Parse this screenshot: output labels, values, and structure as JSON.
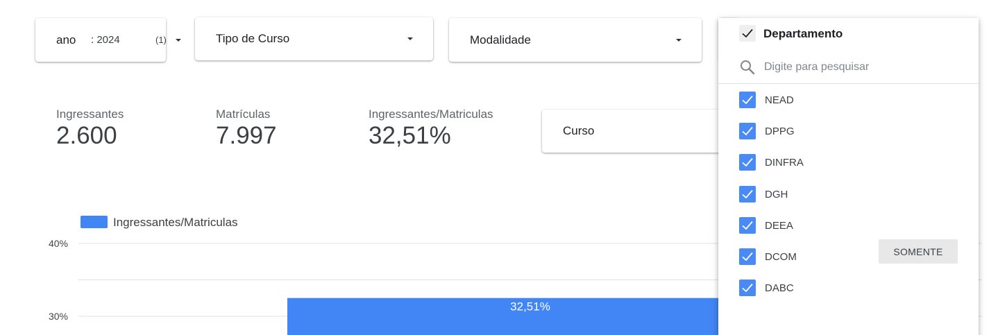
{
  "filters": {
    "ano": {
      "label": "ano",
      "value": "2024",
      "count": "(1)"
    },
    "tipo_curso": {
      "label": "Tipo de Curso"
    },
    "modalidade": {
      "label": "Modalidade"
    },
    "curso": {
      "label": "Curso"
    }
  },
  "kpis": [
    {
      "label": "Ingressantes",
      "value": "2.600"
    },
    {
      "label": "Matrículas",
      "value": "7.997"
    },
    {
      "label": "Ingressantes/Matriculas",
      "value": "32,51%"
    }
  ],
  "chart_data": {
    "type": "bar",
    "categories": [
      ""
    ],
    "series": [
      {
        "name": "Ingressantes/Matriculas",
        "values": [
          32.51
        ]
      }
    ],
    "data_labels": [
      "32,51%"
    ],
    "ytick_labels": [
      "40%",
      "30%"
    ],
    "yticks": [
      40,
      35,
      30
    ],
    "ylim": [
      28,
      40
    ],
    "legend": "top-left",
    "grid": true,
    "color": "#4285f4"
  },
  "dropdown": {
    "title": "Departamento",
    "search_placeholder": "Digite para pesquisar",
    "items": [
      {
        "label": "NEAD",
        "checked": true
      },
      {
        "label": "DPPG",
        "checked": true
      },
      {
        "label": "DINFRA",
        "checked": true
      },
      {
        "label": "DGH",
        "checked": true
      },
      {
        "label": "DEEA",
        "checked": true
      },
      {
        "label": "DCOM",
        "checked": true,
        "only_label": "SOMENTE"
      },
      {
        "label": "DABC",
        "checked": true
      }
    ],
    "accent": "#4a8af4"
  }
}
